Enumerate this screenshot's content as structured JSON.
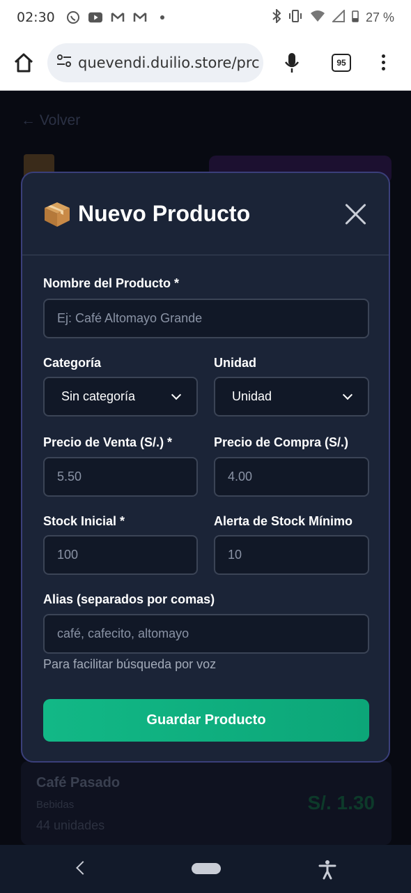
{
  "status_bar": {
    "time": "02:30",
    "battery": "27 %",
    "left_icons": [
      "whatsapp-icon",
      "youtube-icon",
      "gmail-icon",
      "gmail-icon",
      "dot-icon"
    ],
    "right_icons": [
      "bluetooth-icon",
      "vibrate-icon",
      "wifi-icon",
      "signal-icon",
      "battery-icon"
    ]
  },
  "browser": {
    "url": "quevendi.duilio.store/prc",
    "tab_count": "95"
  },
  "background_page": {
    "back_label": "← Volver",
    "card": {
      "title": "Café Pasado",
      "category": "Bebidas",
      "units": "44 unidades",
      "price": "S/. 1.30"
    }
  },
  "modal": {
    "title": "Nuevo Producto",
    "fields": {
      "name": {
        "label": "Nombre del Producto *",
        "placeholder": "Ej: Café Altomayo Grande"
      },
      "category": {
        "label": "Categoría",
        "value": "Sin categoría"
      },
      "unit": {
        "label": "Unidad",
        "value": "Unidad"
      },
      "sale_price": {
        "label": "Precio de Venta (S/.) *",
        "placeholder": "5.50"
      },
      "purchase_price": {
        "label": "Precio de Compra (S/.)",
        "placeholder": "4.00"
      },
      "initial_stock": {
        "label": "Stock Inicial *",
        "placeholder": "100"
      },
      "min_stock_alert": {
        "label": "Alerta de Stock Mínimo",
        "placeholder": "10"
      },
      "aliases": {
        "label": "Alias (separados por comas)",
        "placeholder": "café, cafecito, altomayo",
        "hint": "Para facilitar búsqueda por voz"
      }
    },
    "save_label": "Guardar Producto"
  },
  "colors": {
    "modal_bg": "#1b2437",
    "modal_border": "#3a3f7a",
    "save_button": "#12b886",
    "input_bg": "#111827"
  }
}
